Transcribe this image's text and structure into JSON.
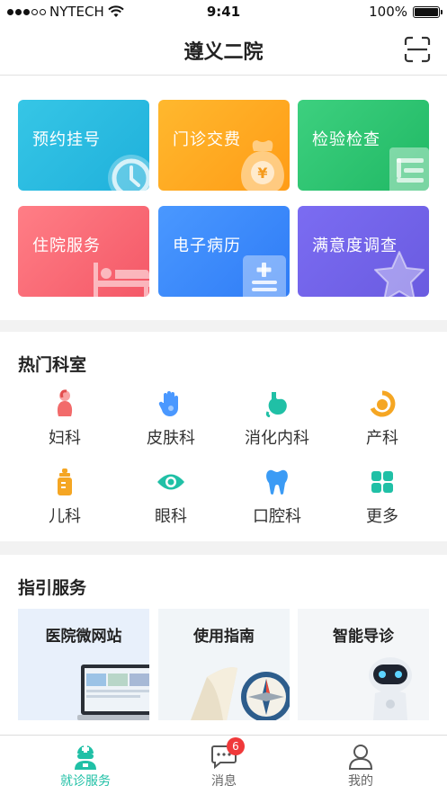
{
  "status": {
    "carrier": "NYTECH",
    "time": "9:41",
    "battery": "100%"
  },
  "header": {
    "title": "遵义二院"
  },
  "quick_services": [
    {
      "label": "预约挂号",
      "color_from": "#36c6e6",
      "color_to": "#1fb0db",
      "icon": "clock-icon"
    },
    {
      "label": "门诊交费",
      "color_from": "#ffb82e",
      "color_to": "#ff9c16",
      "icon": "money-bag-icon"
    },
    {
      "label": "检验检查",
      "color_from": "#3dd07f",
      "color_to": "#20b864",
      "icon": "report-icon"
    },
    {
      "label": "住院服务",
      "color_from": "#ff7e86",
      "color_to": "#f45867",
      "icon": "bed-icon"
    },
    {
      "label": "电子病历",
      "color_from": "#4a98ff",
      "color_to": "#2f7cf6",
      "icon": "medical-record-icon"
    },
    {
      "label": "满意度调查",
      "color_from": "#7b6cf2",
      "color_to": "#6a5be0",
      "icon": "star-icon"
    }
  ],
  "departments": {
    "title": "热门科室",
    "items": [
      {
        "label": "妇科",
        "icon": "woman-icon",
        "color": "#f26b6b"
      },
      {
        "label": "皮肤科",
        "icon": "hand-icon",
        "color": "#3b8df5"
      },
      {
        "label": "消化内科",
        "icon": "stomach-icon",
        "color": "#20c0a6"
      },
      {
        "label": "产科",
        "icon": "baby-icon",
        "color": "#f5a623"
      },
      {
        "label": "儿科",
        "icon": "baby-bottle-icon",
        "color": "#f5a623"
      },
      {
        "label": "眼科",
        "icon": "eye-icon",
        "color": "#20c0a6"
      },
      {
        "label": "口腔科",
        "icon": "tooth-icon",
        "color": "#3b9bf5"
      },
      {
        "label": "更多",
        "icon": "grid-icon",
        "color": "#20c0a6"
      }
    ]
  },
  "guide": {
    "title": "指引服务",
    "items": [
      {
        "label": "医院微网站"
      },
      {
        "label": "使用指南"
      },
      {
        "label": "智能导诊"
      }
    ]
  },
  "tabs": [
    {
      "label": "就诊服务",
      "icon": "doctor-icon",
      "active": true
    },
    {
      "label": "消息",
      "icon": "message-icon",
      "badge": "6"
    },
    {
      "label": "我的",
      "icon": "user-icon"
    }
  ],
  "colors": {
    "accent": "#20c0a6",
    "badge": "#f0393a"
  }
}
